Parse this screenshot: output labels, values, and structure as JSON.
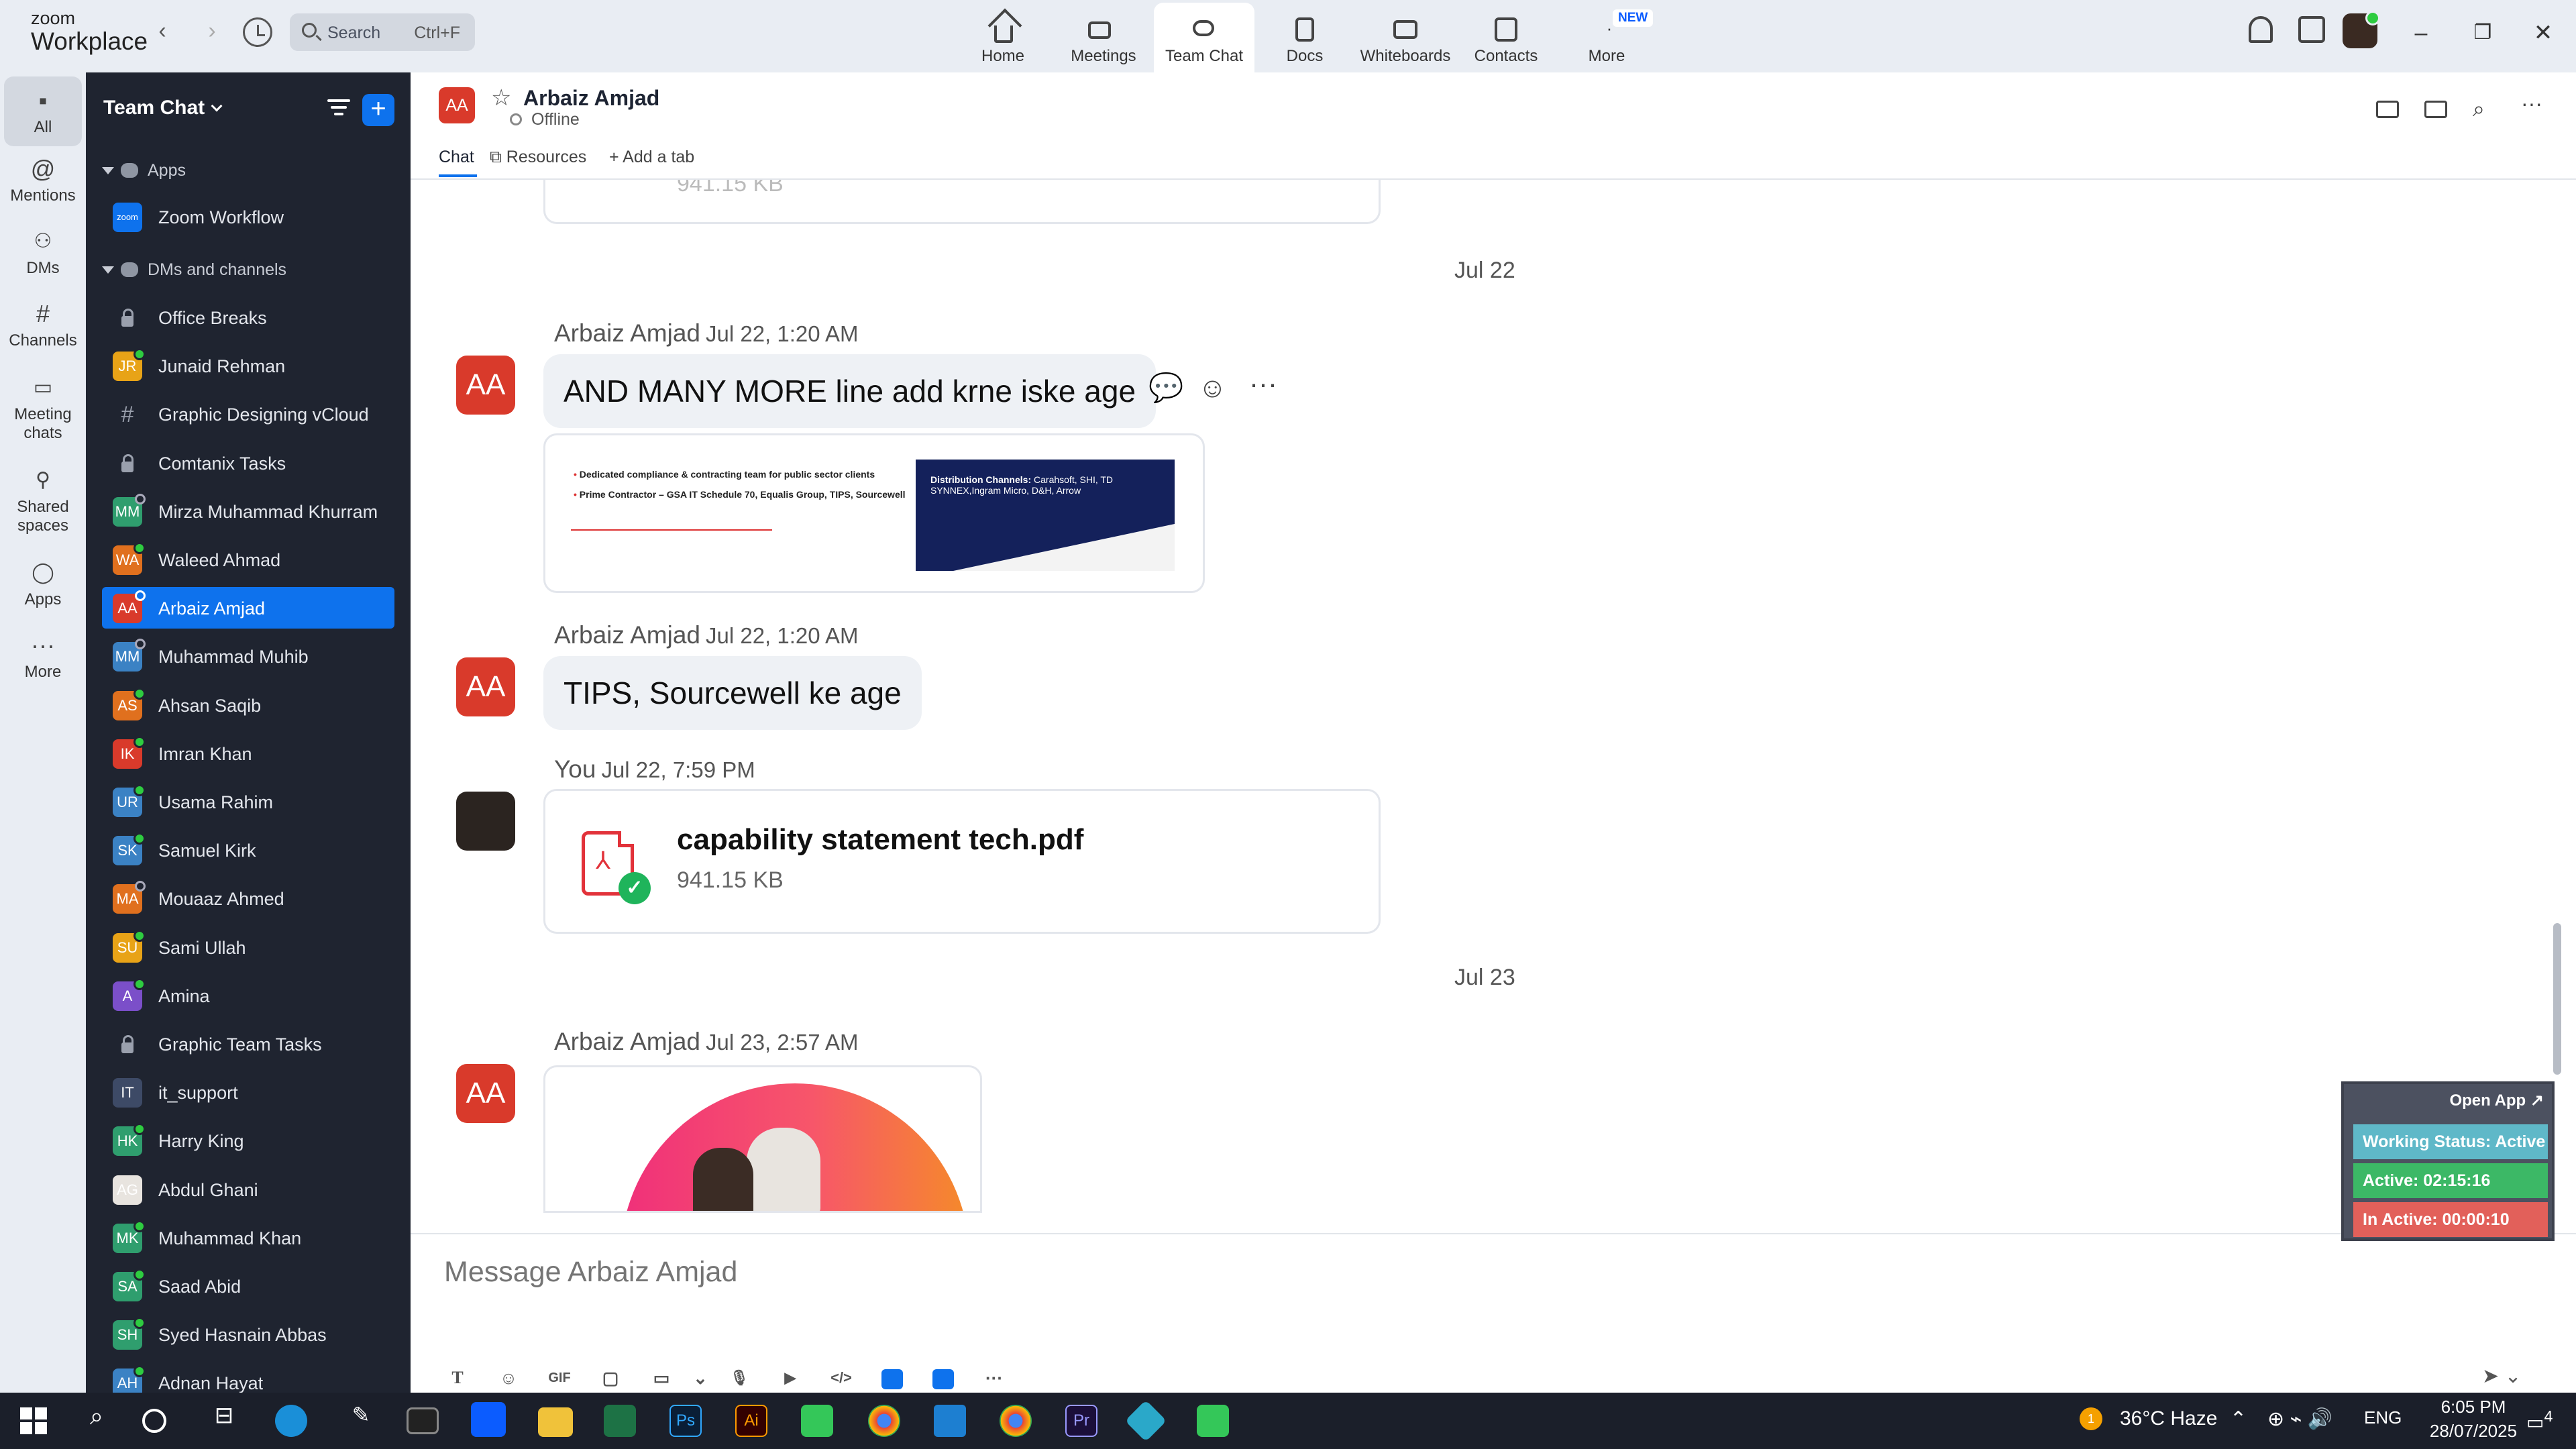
{
  "app": {
    "logo_line1": "zoom",
    "logo_line2": "Workplace",
    "search_placeholder": "Search",
    "search_shortcut": "Ctrl+F"
  },
  "top_tabs": [
    {
      "label": "Home",
      "icon": "home-icon"
    },
    {
      "label": "Meetings",
      "icon": "video-camera-icon"
    },
    {
      "label": "Team Chat",
      "icon": "chat-bubbles-icon",
      "active": true
    },
    {
      "label": "Docs",
      "icon": "document-icon"
    },
    {
      "label": "Whiteboards",
      "icon": "whiteboard-icon"
    },
    {
      "label": "Contacts",
      "icon": "contacts-icon"
    },
    {
      "label": "More",
      "icon": "more-icon",
      "badge": "NEW"
    }
  ],
  "rail": [
    {
      "label": "All",
      "icon": "chat-icon",
      "active": true
    },
    {
      "label": "Mentions",
      "icon": "at-icon"
    },
    {
      "label": "DMs",
      "icon": "people-icon"
    },
    {
      "label": "Channels",
      "icon": "hash-icon"
    },
    {
      "label": "Meeting chats",
      "icon": "calendar-icon"
    },
    {
      "label": "Shared spaces",
      "icon": "shared-icon"
    },
    {
      "label": "Apps",
      "icon": "apps-icon"
    },
    {
      "label": "More",
      "icon": "more-icon"
    }
  ],
  "sidebar": {
    "title": "Team Chat",
    "sections": {
      "apps": "Apps",
      "dms": "DMs and channels"
    },
    "app_item": "Zoom Workflow",
    "items": [
      {
        "name": "Office Breaks",
        "type": "lock"
      },
      {
        "name": "Junaid Rehman",
        "initials": "JR",
        "color": "#e8a317",
        "status": "green"
      },
      {
        "name": "Graphic Designing vCloud",
        "type": "hash"
      },
      {
        "name": "Comtanix Tasks",
        "type": "lock"
      },
      {
        "name": "Mirza Muhammad Khurram",
        "initials": "MM",
        "color": "#2f9e6e",
        "status": "hollow"
      },
      {
        "name": "Waleed Ahmad",
        "initials": "WA",
        "color": "#e0701e",
        "status": "green"
      },
      {
        "name": "Arbaiz Amjad",
        "initials": "AA",
        "color": "#d93a2b",
        "status": "hollow",
        "selected": true
      },
      {
        "name": "Muhammad Muhib",
        "initials": "MM",
        "color": "#3b82c4",
        "status": "hollow"
      },
      {
        "name": "Ahsan Saqib",
        "initials": "AS",
        "color": "#e0701e",
        "status": "green"
      },
      {
        "name": "Imran Khan",
        "initials": "IK",
        "color": "#d93a2b",
        "status": "green"
      },
      {
        "name": "Usama Rahim",
        "initials": "UR",
        "color": "#3b82c4",
        "status": "green"
      },
      {
        "name": "Samuel Kirk",
        "initials": "SK",
        "color": "#3b82c4",
        "status": "green"
      },
      {
        "name": "Mouaaz Ahmed",
        "initials": "MA",
        "color": "#e0701e",
        "status": "hollow"
      },
      {
        "name": "Sami Ullah",
        "initials": "SU",
        "color": "#e8a317",
        "status": "green"
      },
      {
        "name": "Amina",
        "initials": "A",
        "color": "#7b4fc9",
        "status": "green"
      },
      {
        "name": "Graphic Team Tasks",
        "type": "lock"
      },
      {
        "name": "it_support",
        "initials": "IT",
        "color": "#3d4a66",
        "status": "none"
      },
      {
        "name": "Harry King",
        "initials": "HK",
        "color": "#2f9e6e",
        "status": "green"
      },
      {
        "name": "Abdul Ghani",
        "initials": "AG",
        "color": "#e8e4df",
        "status": "none"
      },
      {
        "name": "Muhammad Khan",
        "initials": "MK",
        "color": "#2f9e6e",
        "status": "green"
      },
      {
        "name": "Saad Abid",
        "initials": "SA",
        "color": "#2f9e6e",
        "status": "green"
      },
      {
        "name": "Syed Hasnain Abbas",
        "initials": "SH",
        "color": "#2f9e6e",
        "status": "green"
      },
      {
        "name": "Adnan Hayat",
        "initials": "AH",
        "color": "#3b82c4",
        "status": "green"
      }
    ]
  },
  "chat": {
    "header": {
      "initials": "AA",
      "name": "Arbaiz Amjad",
      "status": "Offline"
    },
    "tabs": {
      "chat": "Chat",
      "resources": "Resources",
      "add": "Add a tab"
    },
    "top_fragment_size": "941.15 KB",
    "date1": "Jul 22",
    "msg1": {
      "sender": "Arbaiz Amjad",
      "time": "Jul 22, 1:20 AM",
      "text": "AND MANY MORE line add krne iske age"
    },
    "slide": {
      "line1": "Dedicated compliance & contracting team for public sector clients",
      "line2": "Prime Contractor – GSA IT Schedule 70, Equalis Group, TIPS, Sourcewell",
      "right_title": "Distribution Channels:",
      "right_text": "Carahsoft, SHI, TD SYNNEX,Ingram Micro, D&H, Arrow"
    },
    "msg2": {
      "sender": "Arbaiz Amjad",
      "time": "Jul 22, 1:20 AM",
      "text": "TIPS, Sourcewell ke age"
    },
    "msg3": {
      "sender": "You",
      "time": "Jul 22, 7:59 PM",
      "file_name": "capability statement tech.pdf",
      "file_size": "941.15 KB"
    },
    "date2": "Jul 23",
    "msg4": {
      "sender": "Arbaiz Amjad",
      "time": "Jul 23, 2:57 AM"
    },
    "composer_placeholder": "Message Arbaiz Amjad",
    "tools": [
      "T",
      "☺",
      "GIF",
      "▢",
      "▭",
      "⌄",
      "🎙",
      "▶",
      "</>",
      "",
      "",
      "···"
    ]
  },
  "widget": {
    "open_app": "Open App ↗",
    "working": "Working Status: Active",
    "active": "Active: 02:15:16",
    "inactive": "In Active: 00:00:10",
    "colors": {
      "working": "#5fb8c8",
      "active": "#3cb866",
      "inactive": "#e2605a"
    }
  },
  "taskbar": {
    "weather": "36°C  Haze",
    "lang": "ENG",
    "time": "6:05 PM",
    "date": "28/07/2025",
    "notif_count": "4",
    "weather_badge": "1"
  }
}
